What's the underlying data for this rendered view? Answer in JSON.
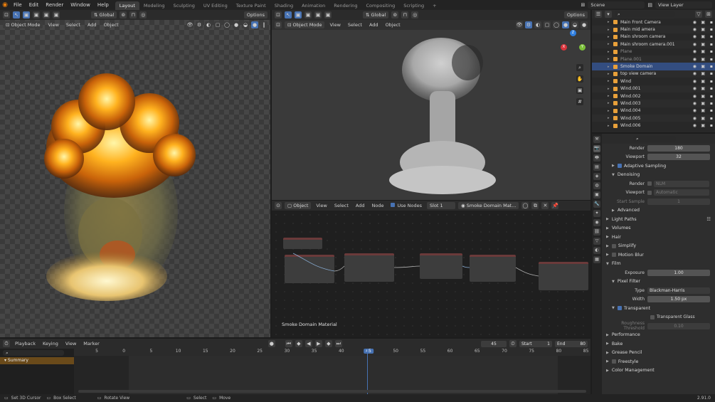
{
  "topbar": {
    "menus": [
      "File",
      "Edit",
      "Render",
      "Window",
      "Help"
    ],
    "workspaces": [
      "Layout",
      "Modeling",
      "Sculpting",
      "UV Editing",
      "Texture Paint",
      "Shading",
      "Animation",
      "Rendering",
      "Compositing",
      "Scripting"
    ],
    "active_workspace": "Layout",
    "plus": "+",
    "scene": "Scene",
    "view_layer": "View Layer"
  },
  "left_header": {
    "orientation": "Global",
    "options": "Options",
    "mode": "Object Mode",
    "menus": [
      "View",
      "Select",
      "Add",
      "Object"
    ]
  },
  "right_header": {
    "orientation": "Global",
    "options": "Options",
    "mode": "Object Mode",
    "menus": [
      "View",
      "Select",
      "Add",
      "Object"
    ]
  },
  "gizmo": {
    "x": "X",
    "y": "Y",
    "z": "Z"
  },
  "node_header": {
    "type": "Object",
    "menus": [
      "View",
      "Select",
      "Add",
      "Node"
    ],
    "use_nodes": "Use Nodes",
    "slot": "Slot 1",
    "material": "Smoke Domain Mat..."
  },
  "node_editor": {
    "label": "Smoke Domain Material"
  },
  "outliner": {
    "items": [
      {
        "name": "Main Front Camera",
        "state": "normal"
      },
      {
        "name": "Main mid amera",
        "state": "normal"
      },
      {
        "name": "Main shroom camera",
        "state": "normal"
      },
      {
        "name": "Main shroom camera.001",
        "state": "normal"
      },
      {
        "name": "Plane",
        "state": "dim"
      },
      {
        "name": "Plane.001",
        "state": "dim"
      },
      {
        "name": "Smoke Domain",
        "state": "selected"
      },
      {
        "name": "top view camera",
        "state": "normal"
      },
      {
        "name": "Wind",
        "state": "normal"
      },
      {
        "name": "Wind.001",
        "state": "normal"
      },
      {
        "name": "Wind.002",
        "state": "normal"
      },
      {
        "name": "Wind.003",
        "state": "normal"
      },
      {
        "name": "Wind.004",
        "state": "normal"
      },
      {
        "name": "Wind.005",
        "state": "normal"
      },
      {
        "name": "Wind.006",
        "state": "normal"
      }
    ]
  },
  "properties": {
    "render_label": "Render",
    "render_value": "180",
    "viewport_label": "Viewport",
    "viewport_value": "32",
    "adaptive_sampling": "Adaptive Sampling",
    "denoising": "Denoising",
    "den_render_label": "Render",
    "den_render_value": "NLM",
    "den_viewport_label": "Viewport",
    "den_viewport_value": "Automatic",
    "start_sample_label": "Start Sample",
    "start_sample_value": "1",
    "advanced": "Advanced",
    "light_paths": "Light Paths",
    "volumes": "Volumes",
    "hair": "Hair",
    "simplify": "Simplify",
    "motion_blur": "Motion Blur",
    "film": "Film",
    "exposure_label": "Exposure",
    "exposure_value": "1.00",
    "pixel_filter": "Pixel Filter",
    "type_label": "Type",
    "type_value": "Blackman-Harris",
    "width_label": "Width",
    "width_value": "1.50 px",
    "transparent": "Transparent",
    "transparent_glass": "Transparent Glass",
    "roughness_label": "Roughness Threshold",
    "roughness_value": "0.10",
    "performance": "Performance",
    "bake": "Bake",
    "grease_pencil": "Grease Pencil",
    "freestyle": "Freestyle",
    "color_management": "Color Management"
  },
  "timeline": {
    "menus": [
      "Playback",
      "Keying",
      "View",
      "Marker"
    ],
    "current_frame": "45",
    "start_label": "Start",
    "start_value": "1",
    "end_label": "End",
    "end_value": "80",
    "summary": "Summary",
    "ruler": [
      "5",
      "0",
      "5",
      "10",
      "15",
      "20",
      "25",
      "30",
      "35",
      "40",
      "45",
      "50",
      "55",
      "60",
      "65",
      "70",
      "75",
      "80",
      "85"
    ]
  },
  "statusbar": {
    "set_cursor": "Set 3D Cursor",
    "box_select": "Box Select",
    "rotate_view": "Rotate View",
    "select": "Select",
    "move": "Move",
    "version": "2.91.0"
  }
}
